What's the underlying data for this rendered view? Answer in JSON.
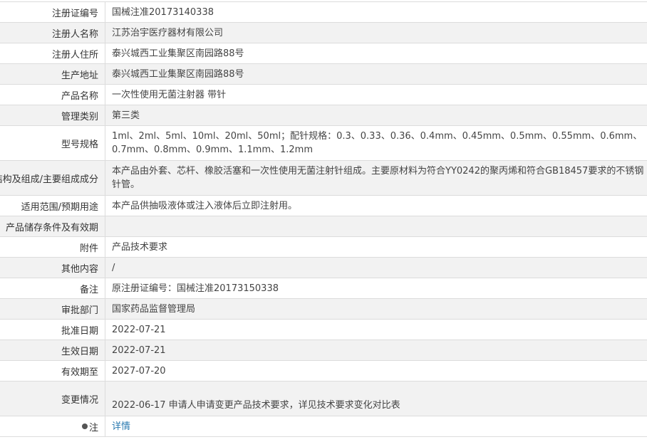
{
  "rows": [
    {
      "label": "注册证编号",
      "value": "国械注准20173140338"
    },
    {
      "label": "注册人名称",
      "value": "江苏治宇医疗器材有限公司"
    },
    {
      "label": "注册人住所",
      "value": "泰兴城西工业集聚区南园路88号"
    },
    {
      "label": "生产地址",
      "value": "泰兴城西工业集聚区南园路88号"
    },
    {
      "label": "产品名称",
      "value": "一次性使用无菌注射器 带针"
    },
    {
      "label": "管理类别",
      "value": "第三类"
    },
    {
      "label": "型号规格",
      "value": "1ml、2ml、5ml、10ml、20ml、50ml；配针规格：0.3、0.33、0.36、0.4mm、0.45mm、0.5mm、0.55mm、0.6mm、0.7mm、0.8mm、0.9mm、1.1mm、1.2mm"
    },
    {
      "label": "结构及组成/主要组成成分",
      "value": "本产品由外套、芯杆、橡胶活塞和一次性使用无菌注射针组成。主要原材料为符合YY0242的聚丙烯和符合GB18457要求的不锈钢针管。"
    },
    {
      "label": "适用范围/预期用途",
      "value": "本产品供抽吸液体或注入液体后立即注射用。"
    },
    {
      "label": "产品储存条件及有效期",
      "value": ""
    },
    {
      "label": "附件",
      "value": "产品技术要求"
    },
    {
      "label": "其他内容",
      "value": "/"
    },
    {
      "label": "备注",
      "value": "原注册证编号：国械注准20173150338"
    },
    {
      "label": "审批部门",
      "value": "国家药品监督管理局"
    },
    {
      "label": "批准日期",
      "value": "2022-07-21"
    },
    {
      "label": "生效日期",
      "value": "2022-07-21"
    },
    {
      "label": "有效期至",
      "value": "2027-07-20"
    },
    {
      "label": "变更情况",
      "value": "2022-06-17 申请人申请变更产品技术要求，详见技术要求变化对比表"
    },
    {
      "label": "注",
      "value": "详情"
    }
  ],
  "icons": {
    "note": "note-bulb-icon"
  },
  "colors": {
    "link": "#2a7ab0",
    "row_shade": "#f2f2f2",
    "border": "#dcdcdc"
  }
}
